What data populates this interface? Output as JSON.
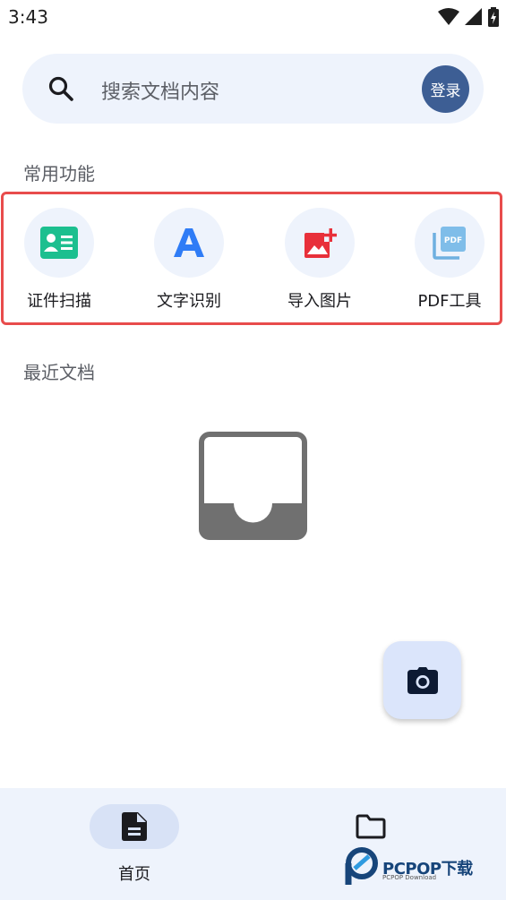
{
  "status_bar": {
    "time": "3:43",
    "icons": [
      "wifi-icon",
      "signal-icon",
      "battery-icon"
    ]
  },
  "search": {
    "placeholder": "搜索文档内容",
    "login_label": "登录"
  },
  "common_functions": {
    "title": "常用功能",
    "items": [
      {
        "label": "证件扫描",
        "icon": "id-card-icon"
      },
      {
        "label": "文字识别",
        "icon": "letter-a-icon"
      },
      {
        "label": "导入图片",
        "icon": "add-image-icon"
      },
      {
        "label": "PDF工具",
        "icon": "pdf-icon"
      }
    ]
  },
  "recent_docs": {
    "title": "最近文档",
    "empty_icon": "empty-inbox-icon"
  },
  "fab": {
    "icon": "camera-icon"
  },
  "bottom_nav": {
    "items": [
      {
        "label": "首页",
        "icon": "document-icon",
        "active": true
      },
      {
        "label": "",
        "icon": "folder-icon",
        "active": false
      }
    ]
  },
  "watermark": {
    "text": "PCPOP下载",
    "sub": "PCPOP Download"
  },
  "colors": {
    "accent": "#3d5e94",
    "surface": "#eef3fc",
    "highlight_border": "#e84c4c",
    "fab": "#dbe5fb"
  }
}
